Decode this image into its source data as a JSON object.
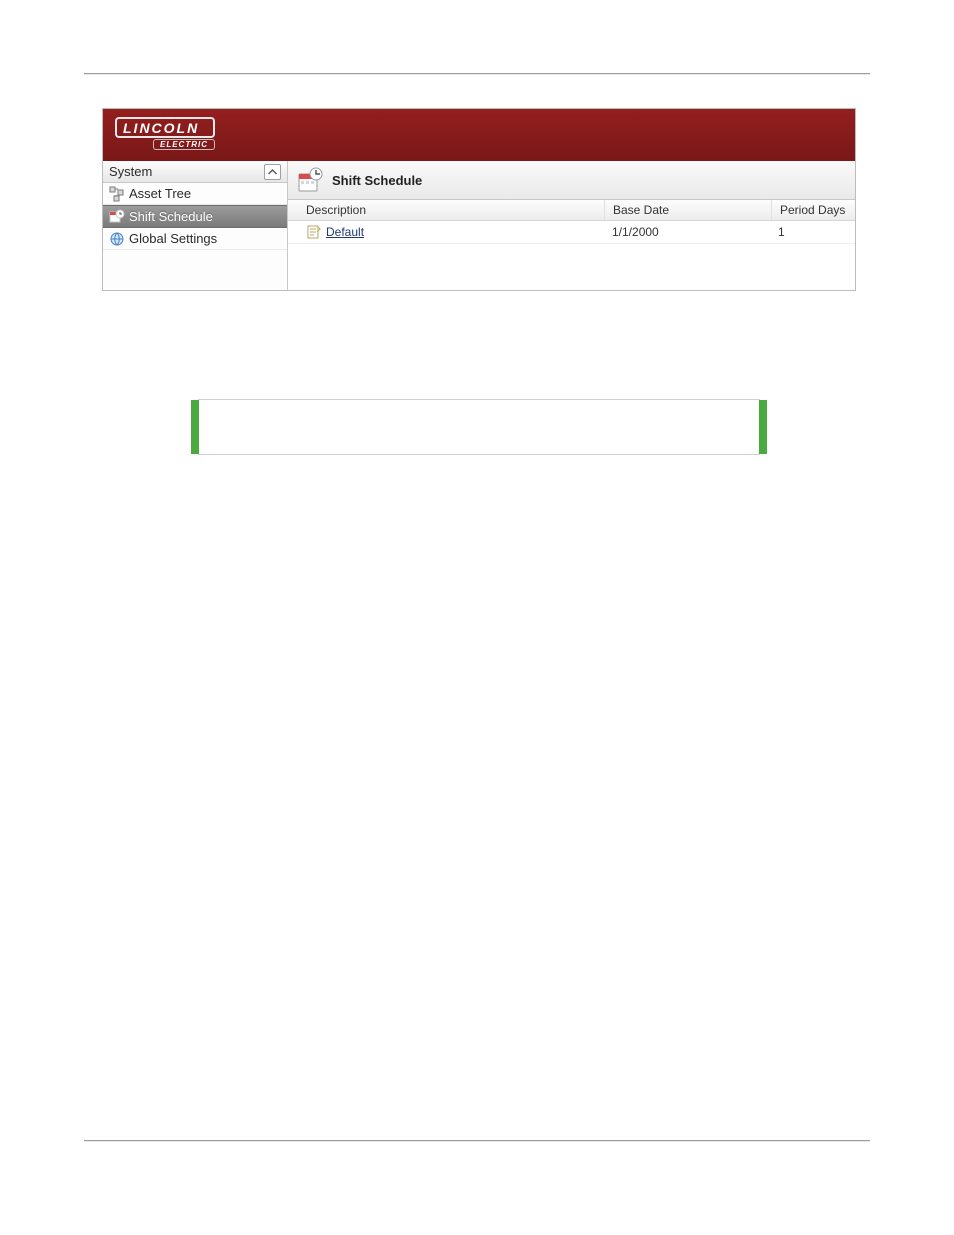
{
  "logo": {
    "top": "LINCOLN",
    "sub": "ELECTRIC"
  },
  "sidebar": {
    "section_label": "System",
    "items": [
      {
        "label": "Asset Tree",
        "selected": false
      },
      {
        "label": "Shift Schedule",
        "selected": true
      },
      {
        "label": "Global Settings",
        "selected": false
      }
    ]
  },
  "main": {
    "title": "Shift Schedule",
    "columns": {
      "description": "Description",
      "base_date": "Base Date",
      "period_days": "Period Days"
    },
    "rows": [
      {
        "description": "Default",
        "base_date": "1/1/2000",
        "period_days": "1"
      }
    ]
  }
}
